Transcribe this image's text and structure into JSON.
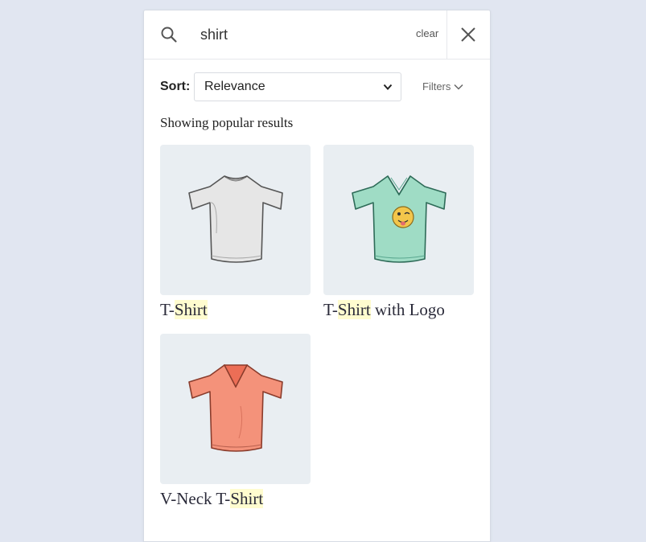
{
  "search": {
    "query": "shirt",
    "clear_label": "clear"
  },
  "sort": {
    "label": "Sort:",
    "selected": "Relevance"
  },
  "filters": {
    "label": "Filters"
  },
  "results": {
    "heading": "Showing popular results",
    "items": [
      {
        "prefix": "T-",
        "match": "Shirt",
        "suffix": "",
        "shirt_color": "#e6e6e6",
        "image": "grey-t-shirt"
      },
      {
        "prefix": "T-",
        "match": "Shirt",
        "suffix": " with Logo",
        "shirt_color": "#9fdcc5",
        "image": "mint-t-shirt-with-emoji-logo"
      },
      {
        "prefix": "V-Neck T-",
        "match": "Shirt",
        "suffix": "",
        "shirt_color": "#f4927a",
        "image": "coral-v-neck-shirt"
      }
    ]
  },
  "colors": {
    "page_bg": "#e1e6f1",
    "highlight": "#fffccf",
    "card_bg": "#e9eef2"
  }
}
